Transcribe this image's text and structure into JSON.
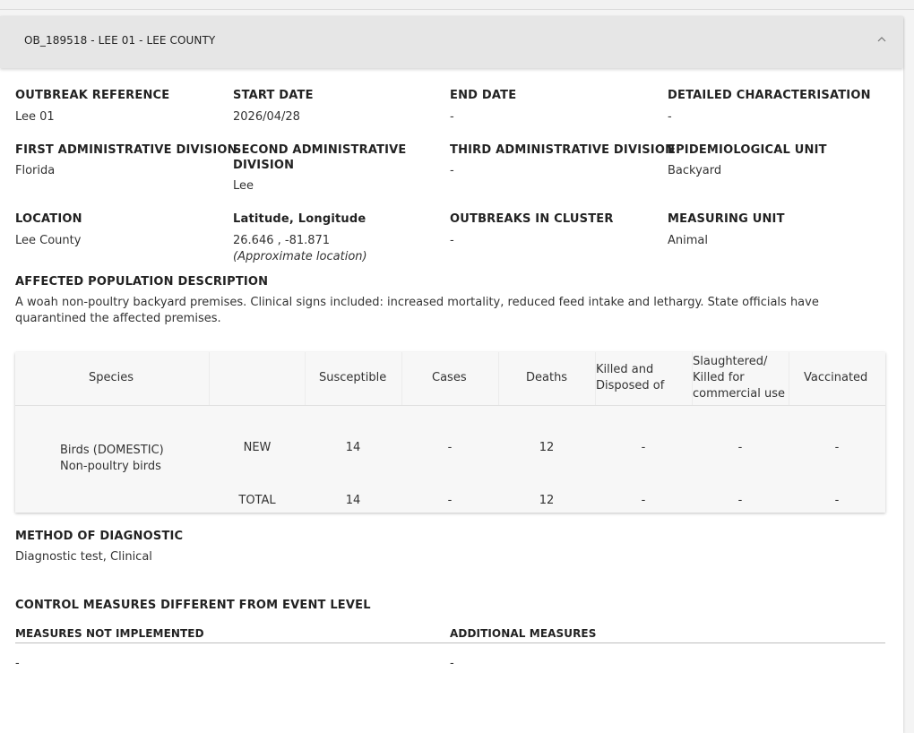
{
  "outbreak": {
    "header_title": "OB_189518 - LEE 01 - LEE COUNTY",
    "fields": [
      {
        "label": "OUTBREAK REFERENCE",
        "value": "Lee 01"
      },
      {
        "label": "START DATE",
        "value": "2026/04/28"
      },
      {
        "label": "END DATE",
        "value": "-"
      },
      {
        "label": "DETAILED CHARACTERISATION",
        "value": "-"
      },
      {
        "label": "FIRST ADMINISTRATIVE DIVISION",
        "value": "Florida"
      },
      {
        "label": "SECOND ADMINISTRATIVE DIVISION",
        "value": "Lee"
      },
      {
        "label": "THIRD ADMINISTRATIVE DIVISION",
        "value": "-"
      },
      {
        "label": "EPIDEMIOLOGICAL UNIT",
        "value": "Backyard"
      },
      {
        "label": "LOCATION",
        "value": "Lee County"
      },
      {
        "label": "Latitude, Longitude",
        "value": "26.646 , -81.871",
        "note": "(Approximate location)"
      },
      {
        "label": "OUTBREAKS IN CLUSTER",
        "value": "-"
      },
      {
        "label": "MEASURING UNIT",
        "value": "Animal"
      }
    ],
    "affected_population": {
      "label": "AFFECTED POPULATION DESCRIPTION",
      "text": "A woah non-poultry backyard premises. Clinical signs included: increased mortality, reduced feed intake and lethargy. State officials have quarantined the affected premises."
    },
    "table": {
      "headers": [
        "Species",
        "Susceptible",
        "Cases",
        "Deaths",
        "Killed and Disposed of",
        "Slaughtered/ Killed for commercial use",
        "Vaccinated"
      ],
      "header_lines": {
        "killed": [
          "Killed and",
          "Disposed of"
        ],
        "slaughtered": [
          "Slaughtered/",
          "Killed for",
          "commercial use"
        ]
      },
      "species_line1": "Birds (DOMESTIC)",
      "species_line2": "Non-poultry birds",
      "rows": [
        {
          "type": "NEW",
          "susceptible": "14",
          "cases": "-",
          "deaths": "12",
          "killed": "-",
          "slaughtered": "-",
          "vaccinated": "-"
        },
        {
          "type": "TOTAL",
          "susceptible": "14",
          "cases": "-",
          "deaths": "12",
          "killed": "-",
          "slaughtered": "-",
          "vaccinated": "-"
        }
      ]
    },
    "diagnostic": {
      "label": "METHOD OF DIAGNOSTIC",
      "value": "Diagnostic test, Clinical"
    },
    "control": {
      "label": "CONTROL MEASURES DIFFERENT FROM EVENT LEVEL",
      "not_implemented_label": "MEASURES NOT IMPLEMENTED",
      "not_implemented_value": "-",
      "additional_label": "ADDITIONAL MEASURES",
      "additional_value": "-"
    }
  },
  "icons": {
    "collapse": "chevron-up-icon"
  }
}
